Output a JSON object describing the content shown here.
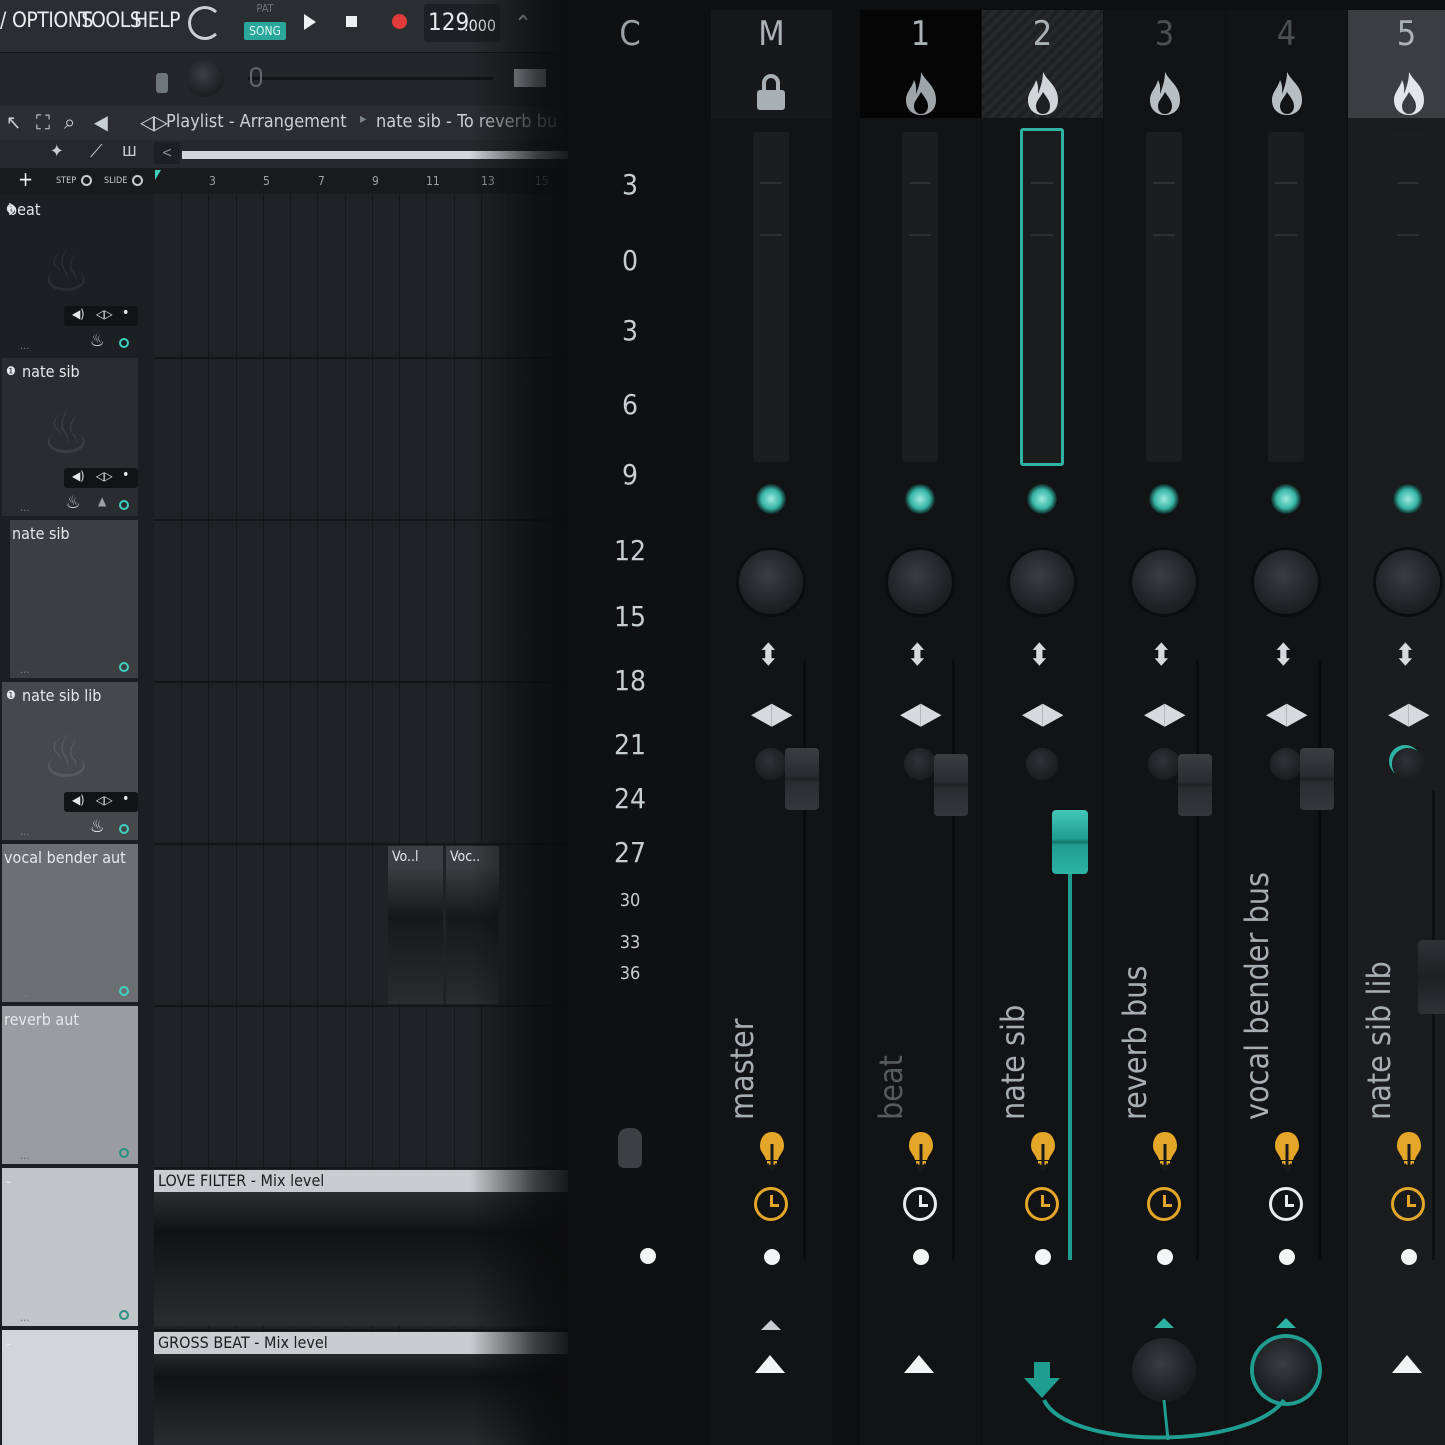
{
  "menu": {
    "items": [
      "OPTIONS",
      "TOOLS",
      "HELP"
    ]
  },
  "transport": {
    "pat_label": "PAT",
    "song_label": "SONG",
    "tempo": "129",
    "tempo_decimals": ".000"
  },
  "playlist": {
    "breadcrumb": [
      "Playlist - Arrangement",
      "nate sib - To reverb bu"
    ],
    "step_label": "STEP",
    "slide_label": "SLIDE",
    "ruler": [
      "3",
      "5",
      "7",
      "9",
      "11",
      "13",
      "15"
    ],
    "tracks": [
      {
        "name": "beat"
      },
      {
        "name": "nate sib"
      },
      {
        "name": "nate sib"
      },
      {
        "name": "nate sib lib"
      },
      {
        "name": "vocal bender aut"
      },
      {
        "name": "reverb aut"
      },
      {
        "name": "-"
      },
      {
        "name": "-"
      }
    ],
    "clips": {
      "vocal_a": "Vo..l",
      "vocal_b": "Voc..",
      "love_filter": "LOVE FILTER - Mix level",
      "gross_beat": "GROSS BEAT - Mix level"
    }
  },
  "mixer": {
    "scale_header": "C",
    "scale": [
      "3",
      "0",
      "3",
      "6",
      "9",
      "12",
      "15",
      "18",
      "21",
      "24",
      "27",
      "30",
      "33",
      "36"
    ],
    "strips": [
      {
        "num": "M",
        "label": "master"
      },
      {
        "num": "1",
        "label": "beat"
      },
      {
        "num": "2",
        "label": "nate sib"
      },
      {
        "num": "3",
        "label": "reverb bus"
      },
      {
        "num": "4",
        "label": "vocal bender bus"
      },
      {
        "num": "5",
        "label": "nate sib lib"
      }
    ],
    "accent_color": "#2fb3a4",
    "clock_color": "#e3a629"
  }
}
